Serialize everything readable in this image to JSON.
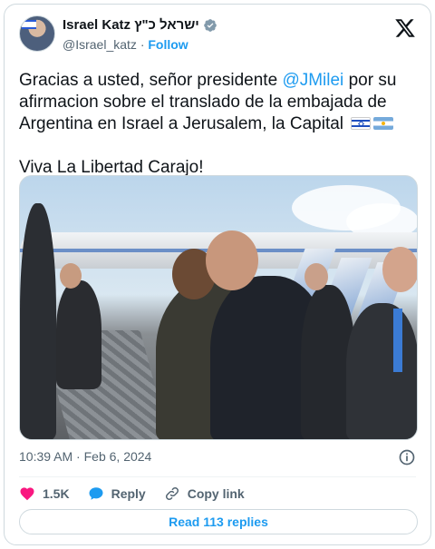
{
  "author": {
    "name": "Israel Katz ישראל כ\"ץ",
    "handle": "@Israel_katz",
    "separator": "·",
    "follow_label": "Follow"
  },
  "tweet": {
    "text_before_mention": "Gracias a usted, señor presidente ",
    "mention": "@JMilei",
    "text_after_mention": " por su afirmacion sobre el translado de la embajada de Argentina en Israel a Jerusalem, la Capital",
    "flags": [
      "flag-israel-icon",
      "flag-argentina-icon"
    ],
    "second_paragraph": "Viva La Libertad Carajo!"
  },
  "meta": {
    "time": "10:39 AM",
    "separator": "·",
    "date": "Feb 6, 2024"
  },
  "actions": {
    "likes_count": "1.5K",
    "reply_label": "Reply",
    "copy_link_label": "Copy link"
  },
  "read_replies_label": "Read 113 replies",
  "colors": {
    "accent": "#1d9bf0",
    "like": "#f91880",
    "text": "#0f1419",
    "secondary": "#536471",
    "border": "#cfd9de"
  }
}
